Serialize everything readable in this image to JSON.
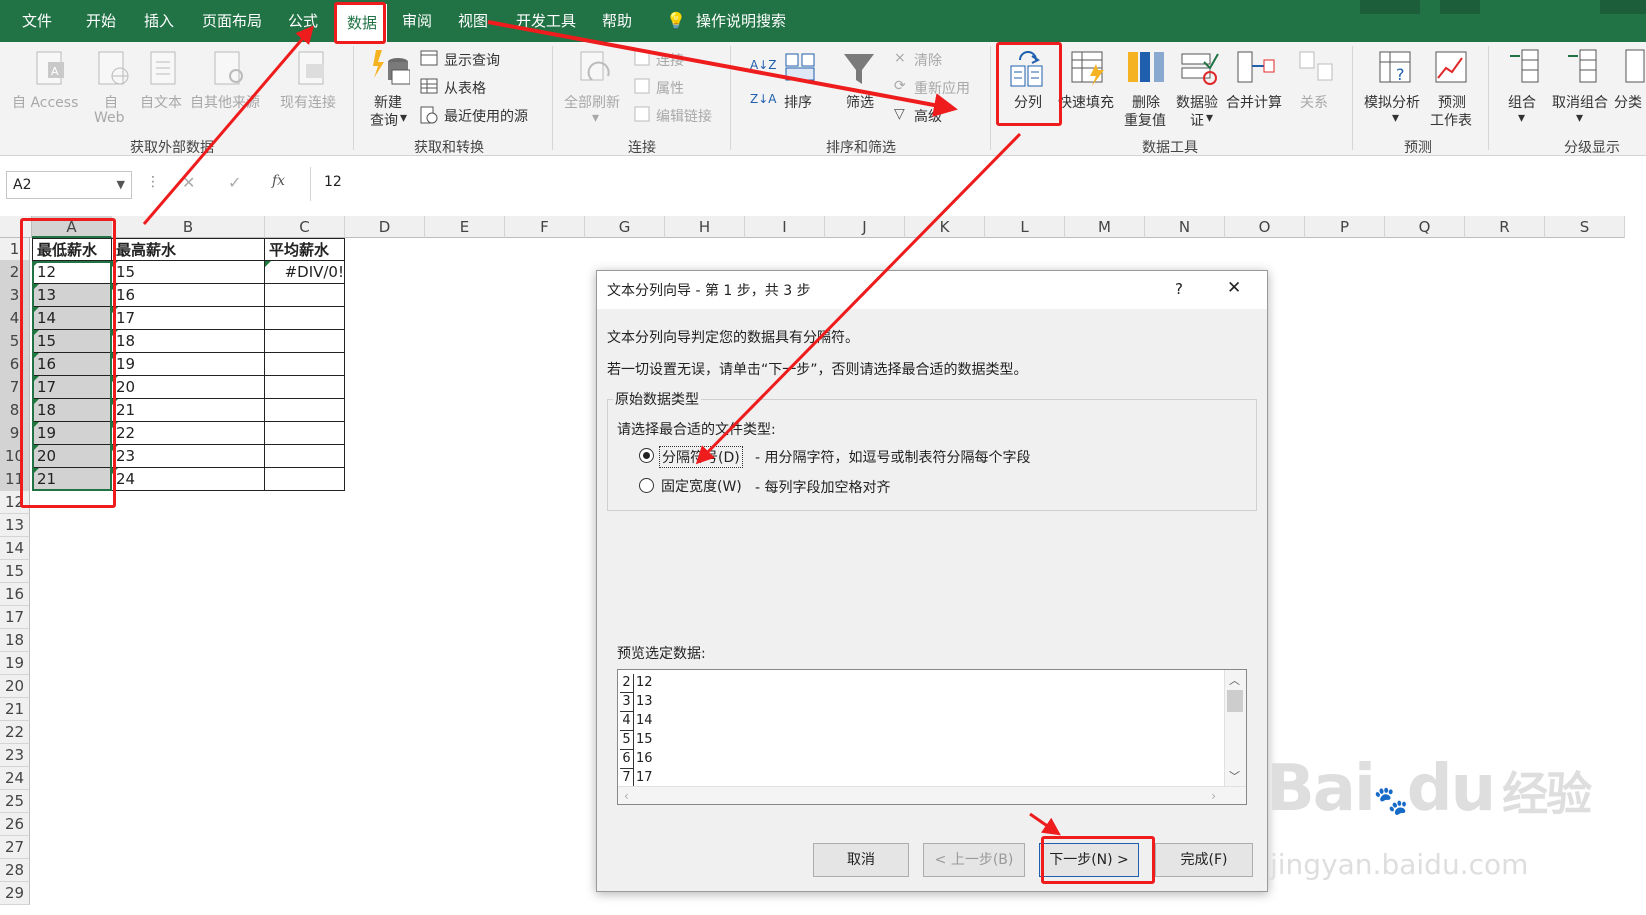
{
  "menu": {
    "tabs": [
      "文件",
      "开始",
      "插入",
      "页面布局",
      "公式",
      "数据",
      "审阅",
      "视图",
      "开发工具",
      "帮助"
    ],
    "tell_me": "操作说明搜索"
  },
  "ribbon": {
    "external": {
      "access": "自 Access",
      "web1": "自",
      "web2": "Web",
      "text": "自文本",
      "other": "自其他来源",
      "existing": "现有连接",
      "label": "获取外部数据"
    },
    "transform": {
      "newq1": "新建",
      "newq2": "查询",
      "show": "显示查询",
      "table": "从表格",
      "recent": "最近使用的源",
      "label": "获取和转换"
    },
    "conn": {
      "refresh": "全部刷新",
      "connections": "连接",
      "properties": "属性",
      "editlinks": "编辑链接",
      "label": "连接"
    },
    "sort": {
      "az": "A↓Z",
      "za": "Z↓A",
      "sort": "排序",
      "filter": "筛选",
      "clear": "清除",
      "reapply": "重新应用",
      "advanced": "高级",
      "label": "排序和筛选"
    },
    "tools": {
      "split": "分列",
      "flash": "快速填充",
      "remdup1": "删除",
      "remdup2": "重复值",
      "valid1": "数据验",
      "valid2": "证",
      "consol": "合并计算",
      "rel": "关系",
      "label": "数据工具"
    },
    "forecast": {
      "whatif": "模拟分析",
      "sheet1": "预测",
      "sheet2": "工作表",
      "label": "预测"
    },
    "outline": {
      "group": "组合",
      "ungroup": "取消组合",
      "subtotal": "分类",
      "label": "分级显示"
    }
  },
  "formula_bar": {
    "name_box": "A2",
    "fx": "fx",
    "value": "12"
  },
  "sheet": {
    "columns": [
      "A",
      "B",
      "C",
      "D",
      "E",
      "F",
      "G",
      "H",
      "I",
      "J",
      "K",
      "L",
      "M",
      "N",
      "O",
      "P",
      "Q",
      "R",
      "S"
    ],
    "rows": [
      "1",
      "2",
      "3",
      "4",
      "5",
      "6",
      "7",
      "8",
      "9",
      "10",
      "11",
      "12",
      "13",
      "14",
      "15",
      "16",
      "17",
      "18",
      "19",
      "20",
      "21",
      "22",
      "23",
      "24",
      "25",
      "26",
      "27",
      "28",
      "29"
    ],
    "headers": [
      "最低薪水",
      "最高薪水",
      "平均薪水"
    ],
    "min_salary": [
      "12",
      "13",
      "14",
      "15",
      "16",
      "17",
      "18",
      "19",
      "20",
      "21"
    ],
    "max_salary": [
      "15",
      "16",
      "17",
      "18",
      "19",
      "20",
      "21",
      "22",
      "23",
      "24"
    ],
    "avg_salary": [
      "#DIV/0!"
    ]
  },
  "dialog": {
    "title": "文本分列向导 - 第 1 步，共 3 步",
    "help": "?",
    "close": "✕",
    "line1": "文本分列向导判定您的数据具有分隔符。",
    "line2": "若一切设置无误，请单击“下一步”，否则请选择最合适的数据类型。",
    "group_title": "原始数据类型",
    "prompt": "请选择最合适的文件类型:",
    "opt1": "分隔符号(D)",
    "opt1_desc": "- 用分隔字符，如逗号或制表符分隔每个字段",
    "opt2": "固定宽度(W)",
    "opt2_desc": "- 每列字段加空格对齐",
    "selected_option": "分隔符号(D)",
    "preview_label": "预览选定数据:",
    "preview_rows": [
      {
        "n": "2",
        "v": "12"
      },
      {
        "n": "3",
        "v": "13"
      },
      {
        "n": "4",
        "v": "14"
      },
      {
        "n": "5",
        "v": "15"
      },
      {
        "n": "6",
        "v": "16"
      },
      {
        "n": "7",
        "v": "17"
      }
    ],
    "btn_cancel": "取消",
    "btn_back": "< 上一步(B)",
    "btn_next": "下一步(N) >",
    "btn_finish": "完成(F)"
  },
  "watermark": {
    "brand": "Bai",
    "brand2": "du",
    "brand_cn": "经验",
    "url": "jingyan.baidu.com"
  },
  "colors": {
    "excel_green": "#217346",
    "annotation_red": "#ee1c1c"
  }
}
